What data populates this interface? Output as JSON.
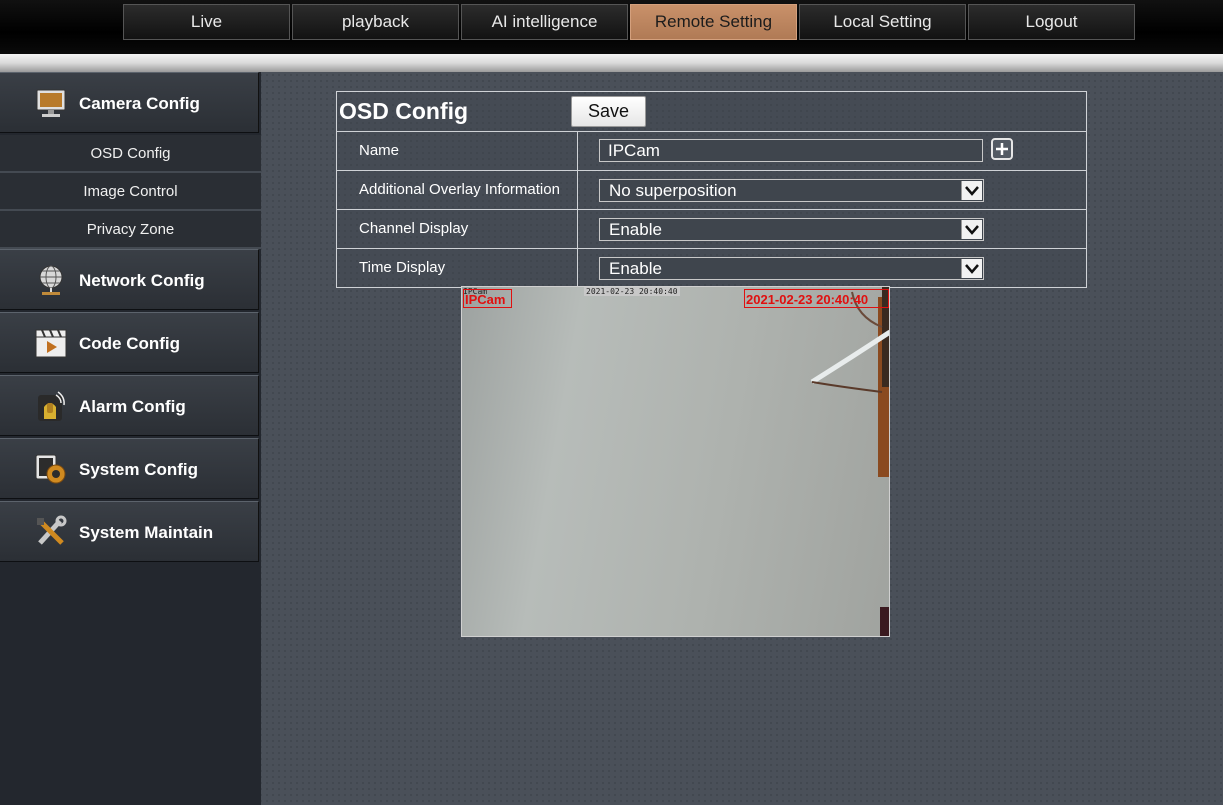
{
  "nav": {
    "tabs": [
      {
        "label": "Live"
      },
      {
        "label": "playback"
      },
      {
        "label": "AI intelligence"
      },
      {
        "label": "Remote Setting"
      },
      {
        "label": "Local Setting"
      },
      {
        "label": "Logout"
      }
    ],
    "active": "Remote Setting"
  },
  "sidebar": {
    "camera_config": {
      "label": "Camera Config",
      "icon": "monitor-icon"
    },
    "sub_items": [
      {
        "label": "OSD Config"
      },
      {
        "label": "Image Control"
      },
      {
        "label": "Privacy Zone"
      }
    ],
    "network_config": {
      "label": "Network Config",
      "icon": "globe-network-icon"
    },
    "code_config": {
      "label": "Code Config",
      "icon": "clapperboard-icon"
    },
    "alarm_config": {
      "label": "Alarm Config",
      "icon": "alarm-icon"
    },
    "system_config": {
      "label": "System Config",
      "icon": "gear-icon"
    },
    "system_maintain": {
      "label": "System Maintain",
      "icon": "tools-icon"
    }
  },
  "osd": {
    "title": "OSD Config",
    "save_label": "Save",
    "name_label": "Name",
    "name_value": "IPCam",
    "overlay_label": "Additional Overlay Information",
    "overlay_value": "No superposition",
    "channel_label": "Channel Display",
    "channel_value": "Enable",
    "time_label": "Time Display",
    "time_value": "Enable"
  },
  "preview": {
    "channel_text": "IPCam",
    "time_text": "2021-02-23 20:40:40",
    "tiny_channel": "IPCam",
    "tiny_time": "2021-02-23 20:40:40"
  },
  "colors": {
    "active_tab": "#c08a62",
    "osd_red": "#e01010",
    "background": "#4a5059"
  }
}
